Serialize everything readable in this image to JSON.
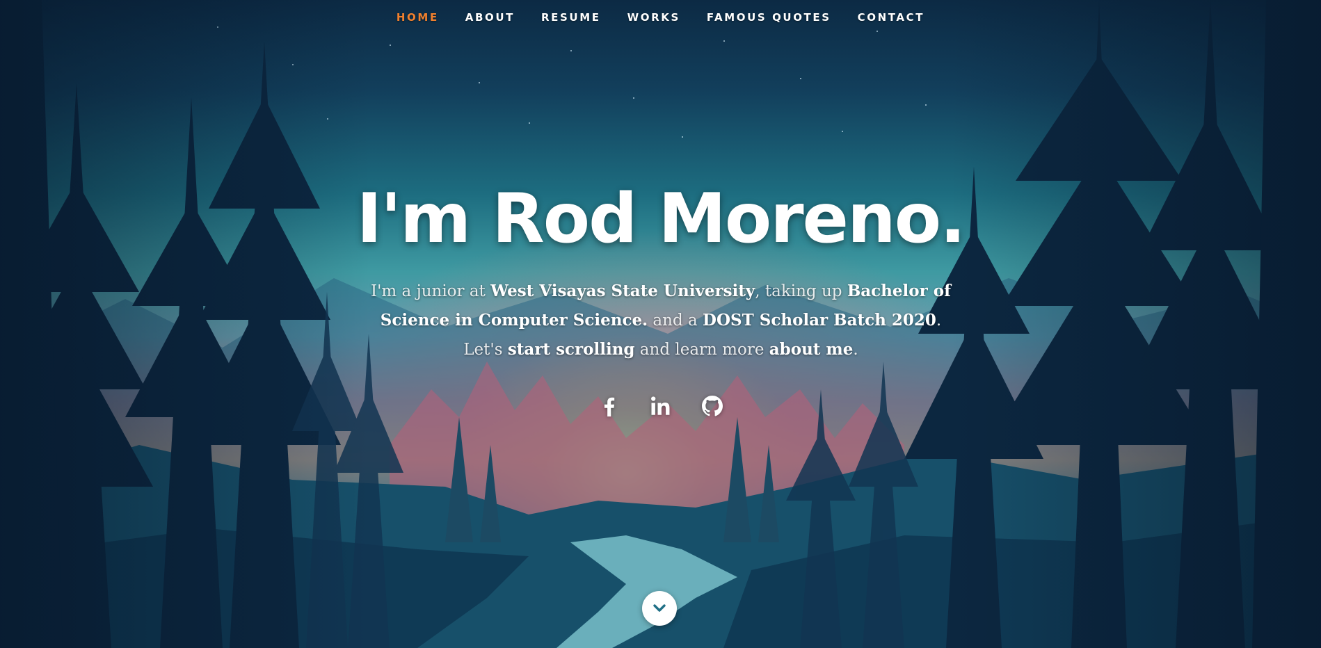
{
  "nav": {
    "items": [
      {
        "label": "HOME",
        "active": true
      },
      {
        "label": "ABOUT",
        "active": false
      },
      {
        "label": "RESUME",
        "active": false
      },
      {
        "label": "WORKS",
        "active": false
      },
      {
        "label": "FAMOUS QUOTES",
        "active": false
      },
      {
        "label": "CONTACT",
        "active": false
      }
    ],
    "active_color": "#f0802e"
  },
  "hero": {
    "headline": "I'm Rod Moreno.",
    "intro": {
      "p1": "I'm a junior at ",
      "university": "West Visayas State University",
      "p2": ", taking up ",
      "degree": "Bachelor of Science in Computer Science.",
      "p3": " and a ",
      "scholar": "DOST Scholar Batch 2020",
      "p4": ". Let's ",
      "scroll": "start scrolling",
      "p5": " and learn more ",
      "about": "about me",
      "p6": "."
    }
  },
  "social": [
    {
      "icon": "facebook-icon"
    },
    {
      "icon": "linkedin-icon"
    },
    {
      "icon": "github-icon"
    }
  ],
  "scroll_button": {
    "icon": "chevron-down-icon"
  }
}
